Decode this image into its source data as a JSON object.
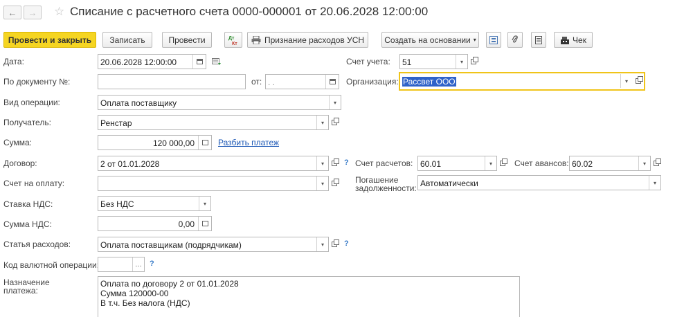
{
  "window": {
    "title": "Списание с расчетного счета 0000-000001 от 20.06.2028 12:00:00"
  },
  "nav": {
    "back": "←",
    "forward": "→",
    "star": "☆"
  },
  "toolbar": {
    "post_close": "Провести и закрыть",
    "save": "Записать",
    "post": "Провести",
    "dtkt": "Дт Кт",
    "usn": "Признание расходов УСН",
    "create_based": "Создать на основании",
    "check": "Чек"
  },
  "form": {
    "date": {
      "label": "Дата:",
      "value": "20.06.2028 12:00:00"
    },
    "doc_number": {
      "label": "По документу №:",
      "value": ""
    },
    "doc_from": {
      "label": "от:",
      "value": " .  ."
    },
    "operation": {
      "label": "Вид операции:",
      "value": "Оплата поставщику"
    },
    "recipient": {
      "label": "Получатель:",
      "value": "Ренстар"
    },
    "amount": {
      "label": "Сумма:",
      "value": "120 000,00"
    },
    "split_payment": "Разбить платеж",
    "contract": {
      "label": "Договор:",
      "value": "2 от 01.01.2028"
    },
    "invoice": {
      "label": "Счет на оплату:",
      "value": ""
    },
    "vat_rate": {
      "label": "Ставка НДС:",
      "value": "Без НДС"
    },
    "vat_amount": {
      "label": "Сумма НДС:",
      "value": "0,00"
    },
    "expense_item": {
      "label": "Статья расходов:",
      "value": "Оплата поставщикам (подрядчикам)"
    },
    "currency_code": {
      "label": "Код валютной операции:",
      "value": ""
    },
    "purpose": {
      "label_line1": "Назначение",
      "label_line2": "платежа:",
      "lines": [
        "Оплата по договору 2 от 01.01.2028",
        "Сумма 120000-00",
        "В т.ч. Без налога (НДС)"
      ]
    },
    "account": {
      "label": "Счет учета:",
      "value": "51"
    },
    "organization": {
      "label": "Организация:",
      "value": "Рассвет ООО"
    },
    "settle_account": {
      "label": "Счет расчетов:",
      "value": "60.01"
    },
    "advance_account": {
      "label": "Счет авансов:",
      "value": "60.02"
    },
    "debt_repayment": {
      "label_line1": "Погашение",
      "label_line2": "задолженности:",
      "value": "Автоматически"
    }
  },
  "help": "?",
  "colors": {
    "primary": "#f5d522",
    "link": "#1b57b5",
    "focus": "#f0c419"
  }
}
